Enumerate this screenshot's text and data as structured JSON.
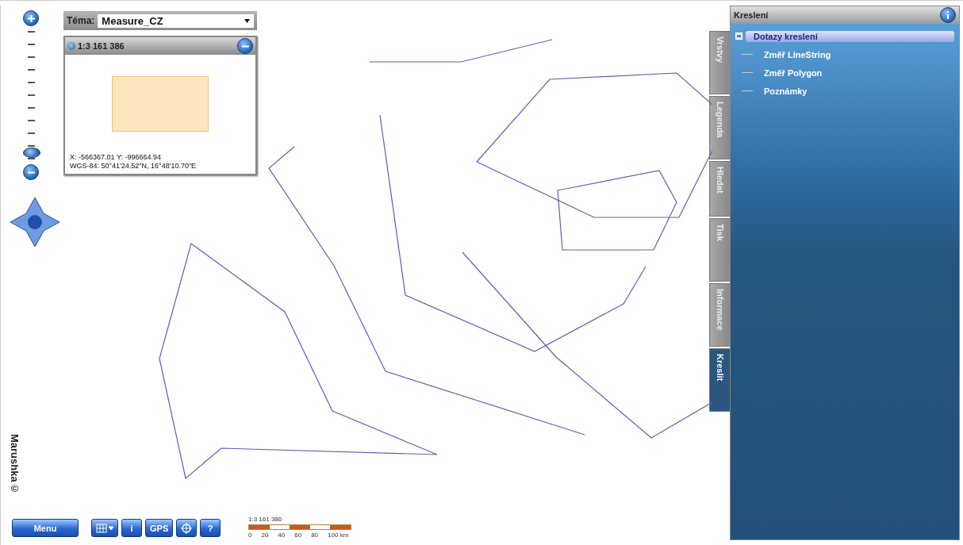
{
  "zoom_bar": {
    "level": 0.05
  },
  "theme": {
    "label": "Téma:",
    "value": "Measure_CZ"
  },
  "overview": {
    "scale": "1:3 161 386",
    "coordinates": [
      "X: -566367.01 Y: -996664.94",
      "WGS-84: 50°41'24.52\"N, 16°48'10.70\"E"
    ]
  },
  "brand": "Marushka©",
  "toolbar": {
    "menu": "Menu",
    "buttons": [
      {
        "kind": "grid"
      },
      {
        "kind": "text",
        "label": "i"
      },
      {
        "kind": "text",
        "label": "GPS"
      },
      {
        "kind": "target"
      },
      {
        "kind": "text",
        "label": "?"
      }
    ]
  },
  "scale_bar": {
    "label": "1:3 161 386",
    "ticks": [
      "0",
      "20",
      "40",
      "60",
      "80",
      "100 km"
    ]
  },
  "side_tabs": [
    {
      "label": "Vrstvy",
      "selected": false
    },
    {
      "label": "Legenda",
      "selected": false
    },
    {
      "label": "Hledat",
      "selected": false
    },
    {
      "label": "Tisk",
      "selected": false
    },
    {
      "label": "Informace",
      "selected": false
    },
    {
      "label": "Kreslit",
      "selected": true
    }
  ],
  "panel": {
    "title": "Kreslení",
    "tree": [
      {
        "label": "Dotazy kreslení",
        "selected": true,
        "expanded": true,
        "children": [
          {
            "label": "Změř LineString",
            "selected": false
          },
          {
            "label": "Změř Polygon",
            "selected": false
          },
          {
            "label": "Poznámky",
            "selected": false
          }
        ]
      }
    ]
  }
}
